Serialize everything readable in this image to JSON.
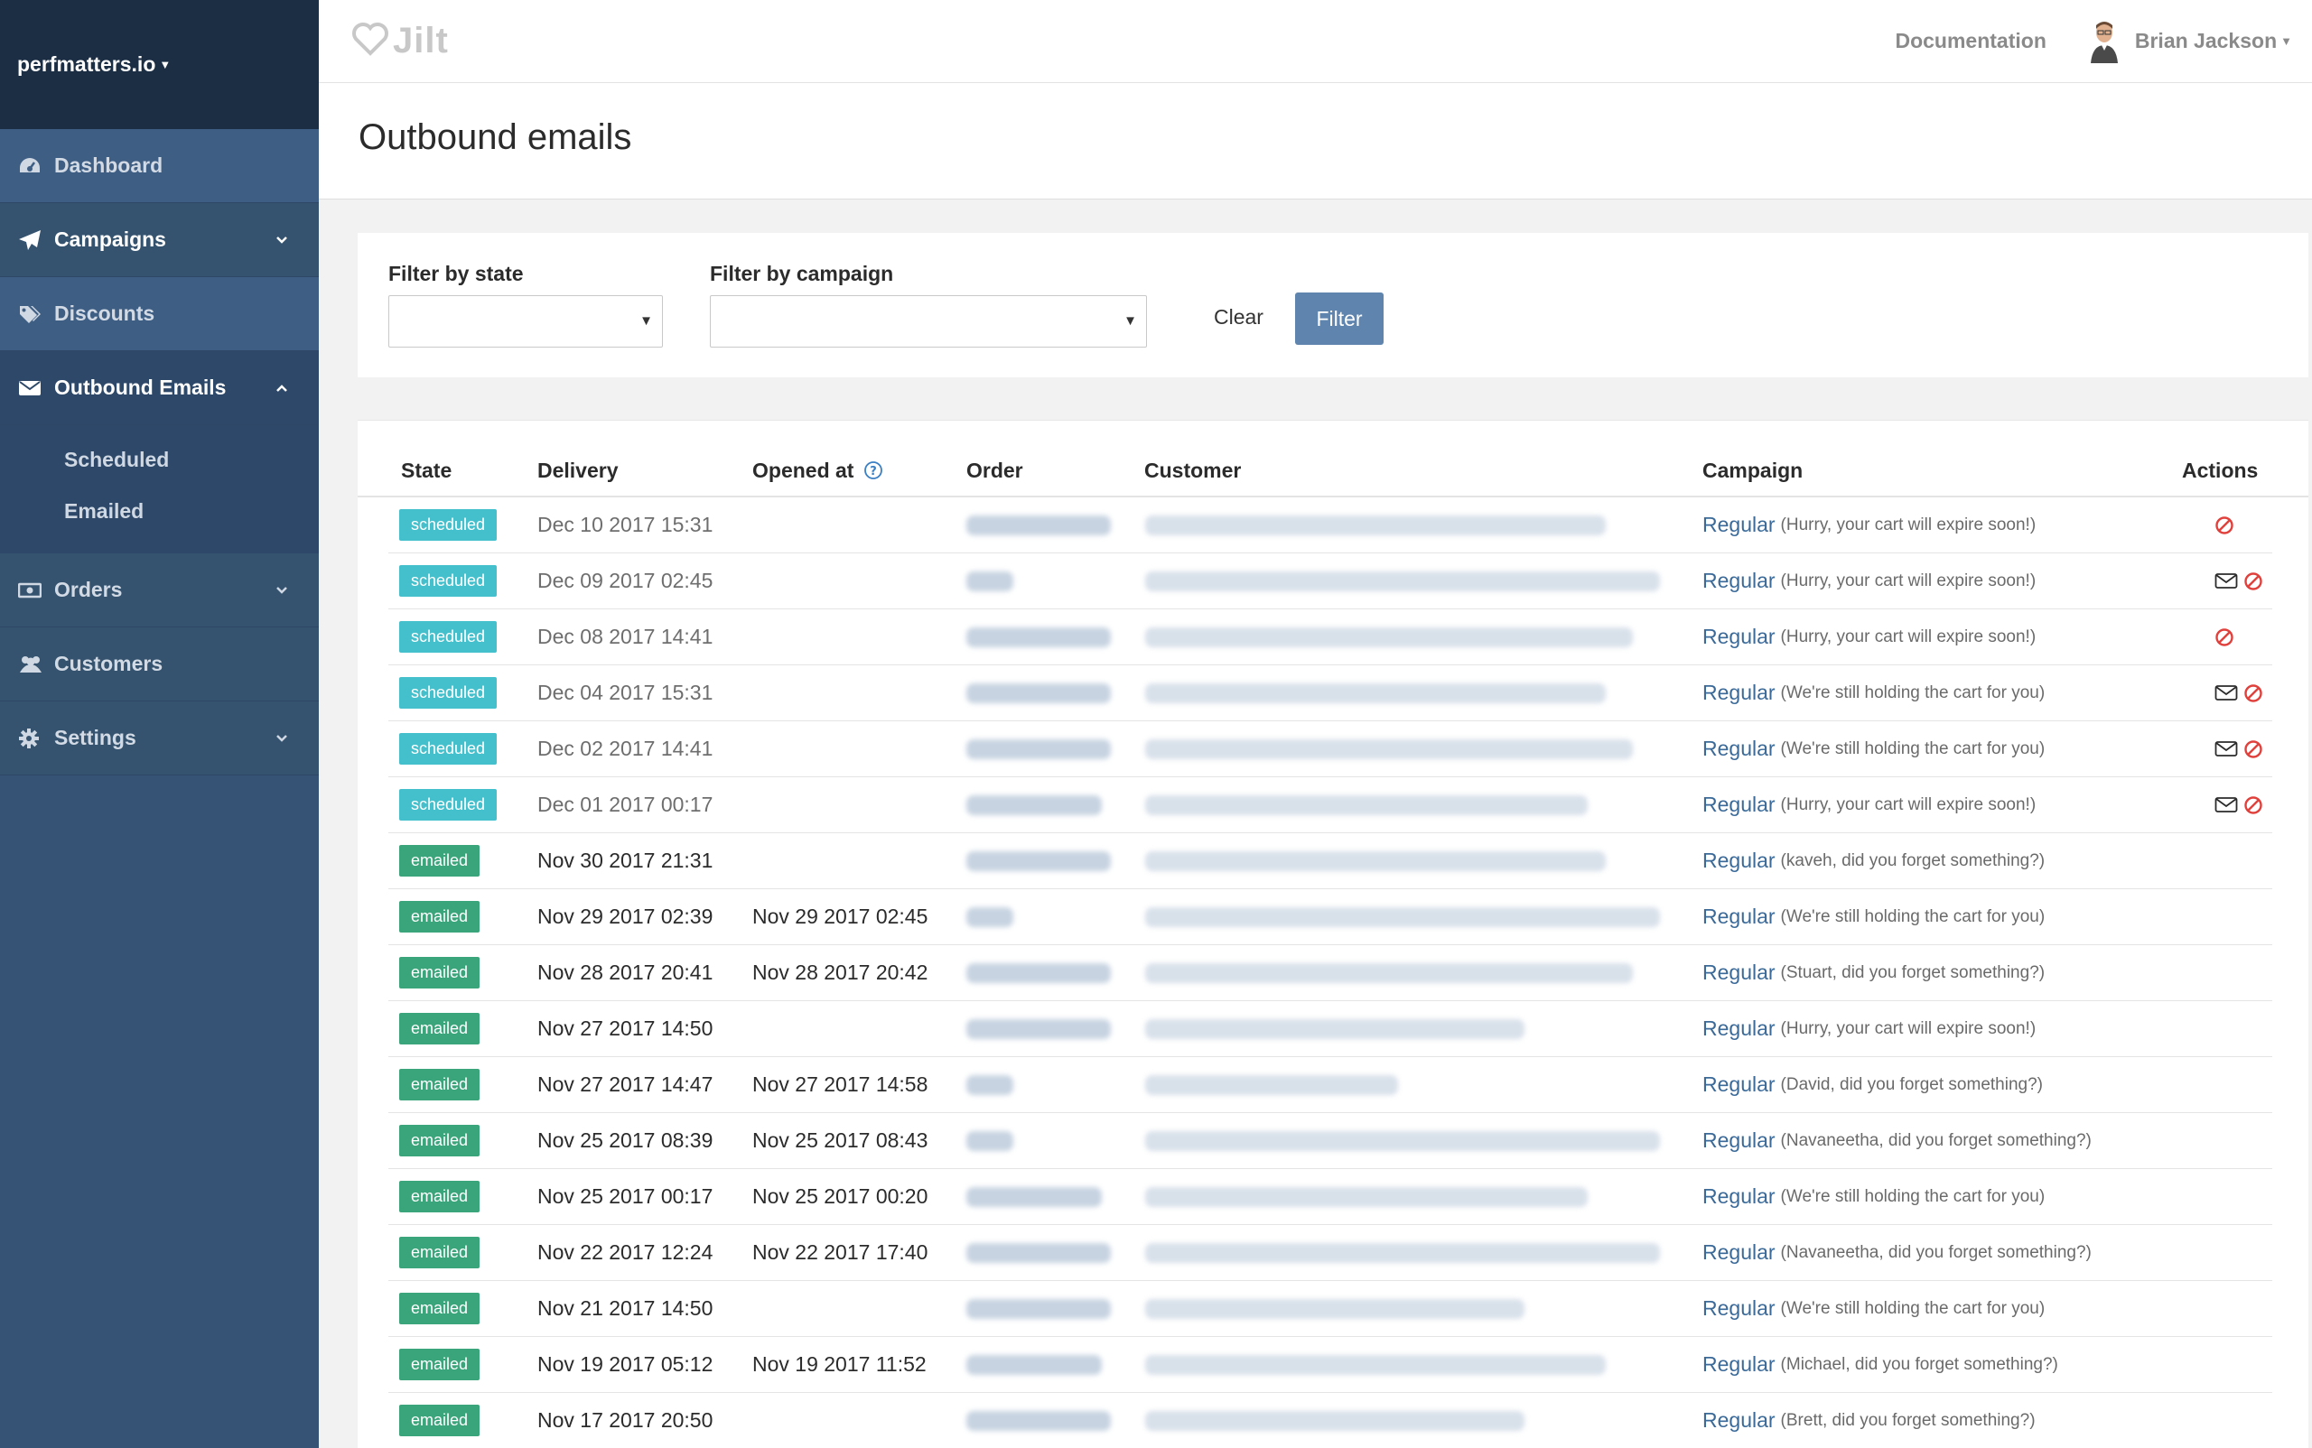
{
  "sidebar": {
    "brand": "perfmatters.io",
    "items": [
      {
        "id": "dashboard",
        "label": "Dashboard",
        "icon": "dashboard-icon",
        "chevron": ""
      },
      {
        "id": "campaigns",
        "label": "Campaigns",
        "icon": "paper-plane-icon",
        "chevron": "down"
      },
      {
        "id": "discounts",
        "label": "Discounts",
        "icon": "tags-icon",
        "chevron": ""
      },
      {
        "id": "outbound-emails",
        "label": "Outbound Emails",
        "icon": "envelope-icon",
        "chevron": "up"
      },
      {
        "id": "orders",
        "label": "Orders",
        "icon": "money-icon",
        "chevron": "down"
      },
      {
        "id": "customers",
        "label": "Customers",
        "icon": "users-icon",
        "chevron": ""
      },
      {
        "id": "settings",
        "label": "Settings",
        "icon": "gear-icon",
        "chevron": "down"
      }
    ],
    "submenu": [
      "Scheduled",
      "Emailed"
    ]
  },
  "topbar": {
    "logo_text": "Jilt",
    "documentation": "Documentation",
    "user_name": "Brian Jackson"
  },
  "page": {
    "title": "Outbound emails"
  },
  "filters": {
    "state_label": "Filter by state",
    "state_value": "",
    "campaign_label": "Filter by campaign",
    "campaign_value": "",
    "clear_label": "Clear",
    "filter_label": "Filter"
  },
  "table": {
    "headers": {
      "state": "State",
      "delivery": "Delivery",
      "opened_at": "Opened at",
      "order": "Order",
      "customer": "Customer",
      "campaign": "Campaign",
      "actions": "Actions"
    },
    "rows": [
      {
        "state": "scheduled",
        "delivery": "Dec 10 2017 15:31",
        "opened": "",
        "campaign": "Regular",
        "note": "(Hurry, your cart will expire soon!)",
        "actions": [
          "cancel"
        ]
      },
      {
        "state": "scheduled",
        "delivery": "Dec 09 2017 02:45",
        "opened": "",
        "campaign": "Regular",
        "note": "(Hurry, your cart will expire soon!)",
        "actions": [
          "send",
          "cancel"
        ]
      },
      {
        "state": "scheduled",
        "delivery": "Dec 08 2017 14:41",
        "opened": "",
        "campaign": "Regular",
        "note": "(Hurry, your cart will expire soon!)",
        "actions": [
          "cancel"
        ]
      },
      {
        "state": "scheduled",
        "delivery": "Dec 04 2017 15:31",
        "opened": "",
        "campaign": "Regular",
        "note": "(We're still holding the cart for you)",
        "actions": [
          "send",
          "cancel"
        ]
      },
      {
        "state": "scheduled",
        "delivery": "Dec 02 2017 14:41",
        "opened": "",
        "campaign": "Regular",
        "note": "(We're still holding the cart for you)",
        "actions": [
          "send",
          "cancel"
        ]
      },
      {
        "state": "scheduled",
        "delivery": "Dec 01 2017 00:17",
        "opened": "",
        "campaign": "Regular",
        "note": "(Hurry, your cart will expire soon!)",
        "actions": [
          "send",
          "cancel"
        ]
      },
      {
        "state": "emailed",
        "delivery": "Nov 30 2017 21:31",
        "opened": "",
        "campaign": "Regular",
        "note": "(kaveh, did you forget something?)",
        "actions": []
      },
      {
        "state": "emailed",
        "delivery": "Nov 29 2017 02:39",
        "opened": "Nov 29 2017 02:45",
        "campaign": "Regular",
        "note": "(We're still holding the cart for you)",
        "actions": []
      },
      {
        "state": "emailed",
        "delivery": "Nov 28 2017 20:41",
        "opened": "Nov 28 2017 20:42",
        "campaign": "Regular",
        "note": "(Stuart, did you forget something?)",
        "actions": []
      },
      {
        "state": "emailed",
        "delivery": "Nov 27 2017 14:50",
        "opened": "",
        "campaign": "Regular",
        "note": "(Hurry, your cart will expire soon!)",
        "actions": []
      },
      {
        "state": "emailed",
        "delivery": "Nov 27 2017 14:47",
        "opened": "Nov 27 2017 14:58",
        "campaign": "Regular",
        "note": "(David, did you forget something?)",
        "actions": []
      },
      {
        "state": "emailed",
        "delivery": "Nov 25 2017 08:39",
        "opened": "Nov 25 2017 08:43",
        "campaign": "Regular",
        "note": "(Navaneetha, did you forget something?)",
        "actions": []
      },
      {
        "state": "emailed",
        "delivery": "Nov 25 2017 00:17",
        "opened": "Nov 25 2017 00:20",
        "campaign": "Regular",
        "note": "(We're still holding the cart for you)",
        "actions": []
      },
      {
        "state": "emailed",
        "delivery": "Nov 22 2017 12:24",
        "opened": "Nov 22 2017 17:40",
        "campaign": "Regular",
        "note": "(Navaneetha, did you forget something?)",
        "actions": []
      },
      {
        "state": "emailed",
        "delivery": "Nov 21 2017 14:50",
        "opened": "",
        "campaign": "Regular",
        "note": "(We're still holding the cart for you)",
        "actions": []
      },
      {
        "state": "emailed",
        "delivery": "Nov 19 2017 05:12",
        "opened": "Nov 19 2017 11:52",
        "campaign": "Regular",
        "note": "(Michael, did you forget something?)",
        "actions": []
      },
      {
        "state": "emailed",
        "delivery": "Nov 17 2017 20:50",
        "opened": "",
        "campaign": "Regular",
        "note": "(Brett, did you forget something?)",
        "actions": []
      }
    ]
  },
  "colors": {
    "sidebar_bg": "#365274",
    "sidebar_brand_bg": "#1c2e44",
    "scheduled_badge": "#43c0cc",
    "emailed_badge": "#3aa57b",
    "filter_button": "#5f84ad",
    "link": "#3b6a99",
    "cancel_icon": "#e0413c"
  }
}
